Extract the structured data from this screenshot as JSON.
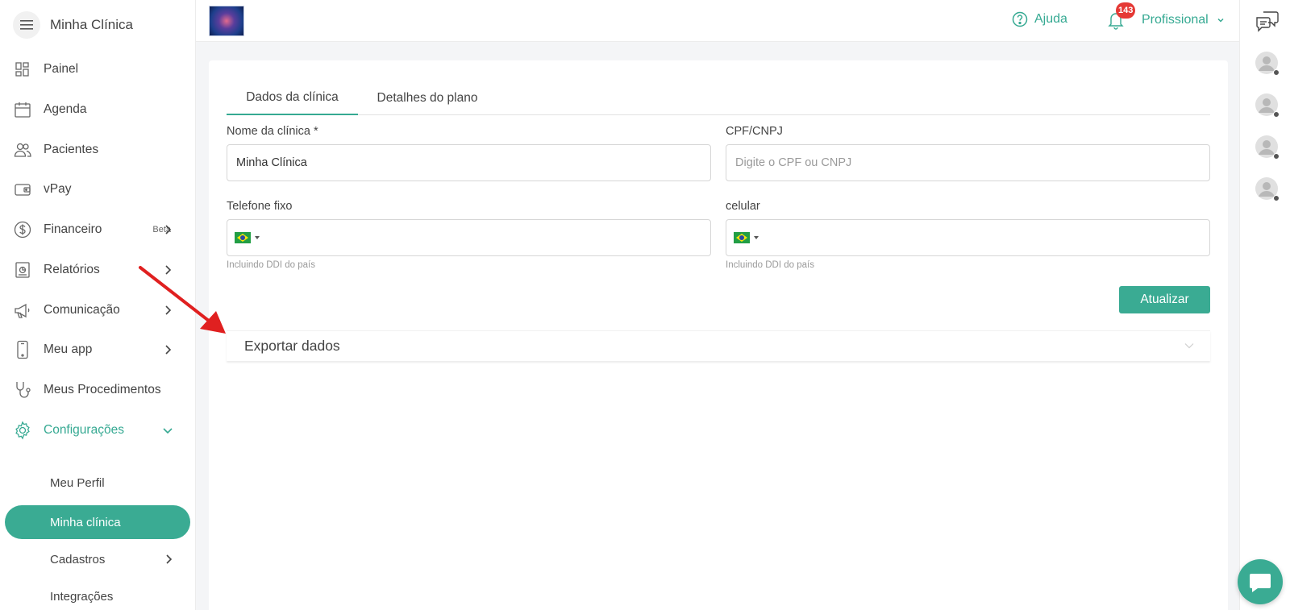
{
  "sidebar": {
    "brand": "Minha Clínica",
    "items": [
      {
        "label": "Painel",
        "icon": "dashboard-icon"
      },
      {
        "label": "Agenda",
        "icon": "calendar-icon"
      },
      {
        "label": "Pacientes",
        "icon": "users-icon"
      },
      {
        "label": "vPay",
        "icon": "wallet-icon"
      },
      {
        "label": "Financeiro",
        "badge": "Beta",
        "icon": "dollar-icon"
      },
      {
        "label": "Relatórios",
        "icon": "report-icon"
      },
      {
        "label": "Comunicação",
        "icon": "megaphone-icon"
      },
      {
        "label": "Meu app",
        "icon": "phone-icon"
      },
      {
        "label": "Meus Procedimentos",
        "icon": "stethoscope-icon"
      },
      {
        "label": "Configurações",
        "icon": "gear-icon"
      }
    ],
    "subitems": [
      {
        "label": "Meu Perfil"
      },
      {
        "label": "Minha clínica"
      },
      {
        "label": "Cadastros"
      },
      {
        "label": "Integrações"
      }
    ]
  },
  "topbar": {
    "help_label": "Ajuda",
    "notification_count": "143",
    "profile_label": "Profissional"
  },
  "tabs": [
    {
      "label": "Dados da clínica"
    },
    {
      "label": "Detalhes do plano"
    }
  ],
  "form": {
    "clinic_name_label": "Nome da clínica *",
    "clinic_name_value": "Minha Clínica",
    "document_label": "CPF/CNPJ",
    "document_placeholder": "Digite o CPF ou CNPJ",
    "landline_label": "Telefone fixo",
    "landline_hint": "Incluindo DDI do país",
    "mobile_label": "celular",
    "mobile_hint": "Incluindo DDI do país",
    "submit_label": "Atualizar"
  },
  "accordion": {
    "export_label": "Exportar dados"
  },
  "colors": {
    "accent": "#3aab93",
    "badge": "#e53935",
    "annotation_arrow": "#e02020"
  }
}
